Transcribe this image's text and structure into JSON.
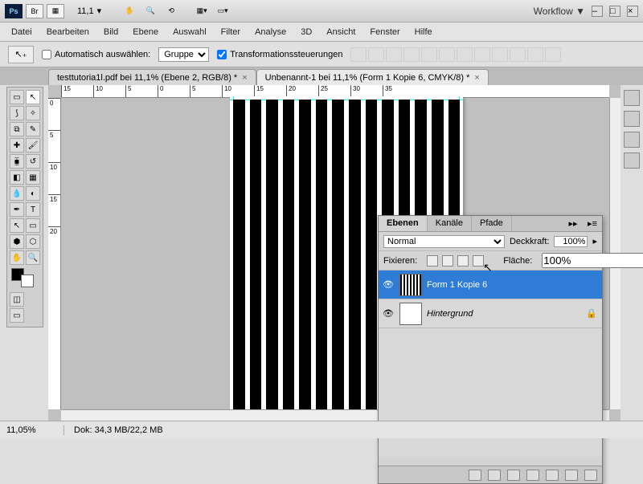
{
  "titlebar": {
    "zoom": "11,1",
    "workflow": "Workflow ▼"
  },
  "menu": [
    "Datei",
    "Bearbeiten",
    "Bild",
    "Ebene",
    "Auswahl",
    "Filter",
    "Analyse",
    "3D",
    "Ansicht",
    "Fenster",
    "Hilfe"
  ],
  "options": {
    "auto_select": "Automatisch auswählen:",
    "group": "Gruppe",
    "transform": "Transformationssteuerungen"
  },
  "tabs": [
    {
      "label": "testtutoria1l.pdf bei 11,1% (Ebene 2, RGB/8) *",
      "active": false
    },
    {
      "label": "Unbenannt-1 bei 11,1% (Form 1 Kopie 6, CMYK/8) *",
      "active": true
    }
  ],
  "ruler_h": [
    "15",
    "10",
    "5",
    "0",
    "5",
    "10",
    "15",
    "20",
    "25",
    "30",
    "35"
  ],
  "ruler_v": [
    "0",
    "5",
    "10",
    "15",
    "20"
  ],
  "panel": {
    "tabs": [
      "Ebenen",
      "Kanäle",
      "Pfade"
    ],
    "blend": "Normal",
    "opacity_label": "Deckkraft:",
    "opacity": "100%",
    "lock_label": "Fixieren:",
    "fill_label": "Fläche:",
    "fill": "100%",
    "layers": [
      {
        "name": "Form 1 Kopie 6",
        "selected": true,
        "stripes": true,
        "locked": false,
        "italic": false
      },
      {
        "name": "Hintergrund",
        "selected": false,
        "stripes": false,
        "locked": true,
        "italic": true
      }
    ]
  },
  "status": {
    "zoom": "11,05%",
    "doc": "Dok: 34,3 MB/22,2 MB"
  }
}
